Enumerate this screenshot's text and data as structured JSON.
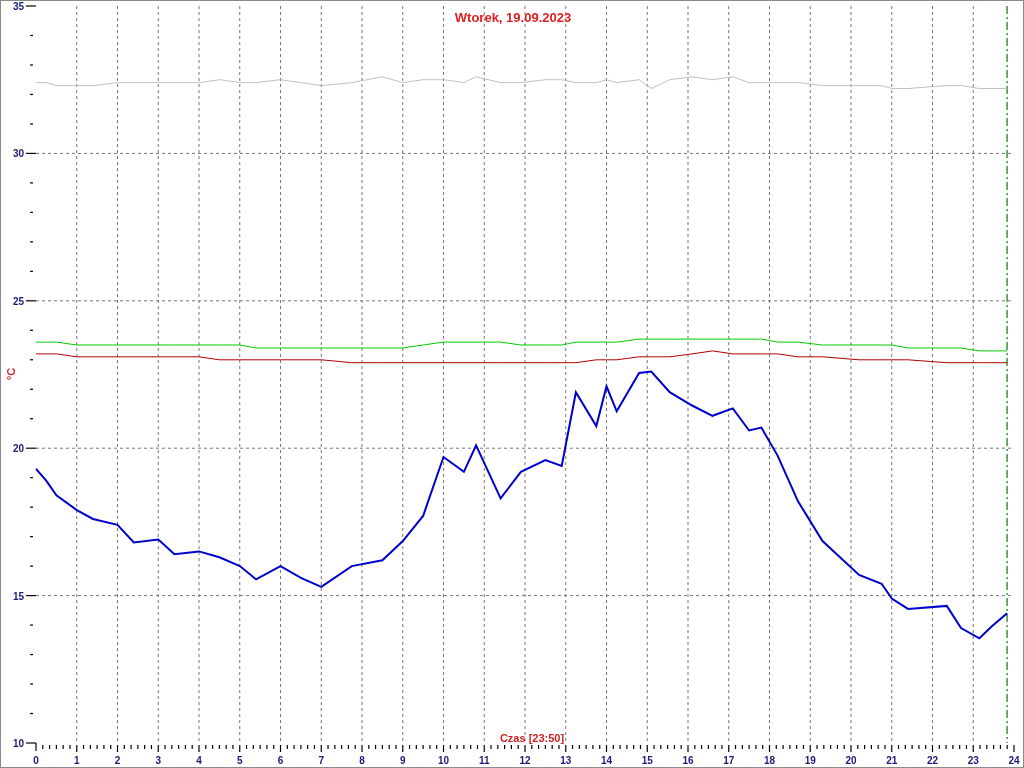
{
  "chart_data": {
    "type": "line",
    "title": "Wtorek, 19.09.2023",
    "xlabel": "Czas [23:50]",
    "ylabel": "°C",
    "x": [
      0,
      0.25,
      0.5,
      1,
      1.4,
      2,
      2.4,
      3,
      3.4,
      4,
      4.5,
      5,
      5.4,
      6,
      6.5,
      7,
      7.75,
      8.5,
      9,
      9.5,
      10,
      10.5,
      10.8,
      11.4,
      11.9,
      12.5,
      12.9,
      13.25,
      13.75,
      14,
      14.25,
      14.8,
      15.1,
      15.55,
      16.1,
      16.6,
      17.1,
      17.5,
      17.8,
      18.2,
      18.7,
      19.3,
      20.2,
      20.75,
      21,
      21.4,
      22.35,
      22.7,
      23.15,
      23.45,
      23.83
    ],
    "series": [
      {
        "color": "#c0c0c0",
        "values": [
          32.4,
          32.4,
          32.3,
          32.3,
          32.3,
          32.4,
          32.4,
          32.4,
          32.4,
          32.4,
          32.5,
          32.4,
          32.4,
          32.5,
          32.4,
          32.3,
          32.4,
          32.6,
          32.4,
          32.5,
          32.5,
          32.4,
          32.6,
          32.4,
          32.4,
          32.5,
          32.5,
          32.4,
          32.4,
          32.5,
          32.4,
          32.5,
          32.2,
          32.5,
          32.6,
          32.5,
          32.6,
          32.4,
          32.4,
          32.4,
          32.4,
          32.3,
          32.3,
          32.3,
          32.2,
          32.2,
          32.3,
          32.3,
          32.2,
          32.2,
          32.2
        ]
      },
      {
        "color": "#00cc00",
        "values": [
          23.6,
          23.6,
          23.6,
          23.5,
          23.5,
          23.5,
          23.5,
          23.5,
          23.5,
          23.5,
          23.5,
          23.5,
          23.4,
          23.4,
          23.4,
          23.4,
          23.4,
          23.4,
          23.4,
          23.5,
          23.6,
          23.6,
          23.6,
          23.6,
          23.5,
          23.5,
          23.5,
          23.6,
          23.6,
          23.6,
          23.6,
          23.7,
          23.7,
          23.7,
          23.7,
          23.7,
          23.7,
          23.7,
          23.7,
          23.6,
          23.6,
          23.5,
          23.5,
          23.5,
          23.5,
          23.4,
          23.4,
          23.4,
          23.3,
          23.3,
          23.3
        ]
      },
      {
        "color": "#b00000",
        "values": [
          23.2,
          23.2,
          23.2,
          23.1,
          23.1,
          23.1,
          23.1,
          23.1,
          23.1,
          23.1,
          23.0,
          23.0,
          23.0,
          23.0,
          23.0,
          23.0,
          22.9,
          22.9,
          22.9,
          22.9,
          22.9,
          22.9,
          22.9,
          22.9,
          22.9,
          22.9,
          22.9,
          22.9,
          23.0,
          23.0,
          23.0,
          23.1,
          23.1,
          23.1,
          23.2,
          23.3,
          23.2,
          23.2,
          23.2,
          23.2,
          23.1,
          23.1,
          23.0,
          23.0,
          23.0,
          23.0,
          22.9,
          22.9,
          22.9,
          22.9,
          22.9
        ]
      },
      {
        "color": "#0000cc",
        "values": [
          19.3,
          18.9,
          18.4,
          17.9,
          17.6,
          17.4,
          16.8,
          16.9,
          16.4,
          16.5,
          16.3,
          16.0,
          15.55,
          16.0,
          15.6,
          15.3,
          16.0,
          16.2,
          16.85,
          17.7,
          19.7,
          19.2,
          20.1,
          18.3,
          19.2,
          19.6,
          19.4,
          21.9,
          20.75,
          22.1,
          21.25,
          22.55,
          22.6,
          21.9,
          21.45,
          21.1,
          21.35,
          20.6,
          20.7,
          19.75,
          18.2,
          16.85,
          15.7,
          15.4,
          14.9,
          14.55,
          14.65,
          13.9,
          13.55,
          13.95,
          14.4
        ]
      }
    ],
    "xlim": [
      0,
      24
    ],
    "ylim": [
      10,
      35
    ],
    "xticks": [
      0,
      1,
      2,
      3,
      4,
      5,
      6,
      7,
      8,
      9,
      10,
      11,
      12,
      13,
      14,
      15,
      16,
      17,
      18,
      19,
      20,
      21,
      22,
      23,
      24
    ],
    "yticks": [
      10,
      15,
      20,
      25,
      30,
      35
    ],
    "grid": true,
    "ref_lines": [
      {
        "axis": "x",
        "value": 23.83,
        "color": "#008000"
      }
    ]
  }
}
